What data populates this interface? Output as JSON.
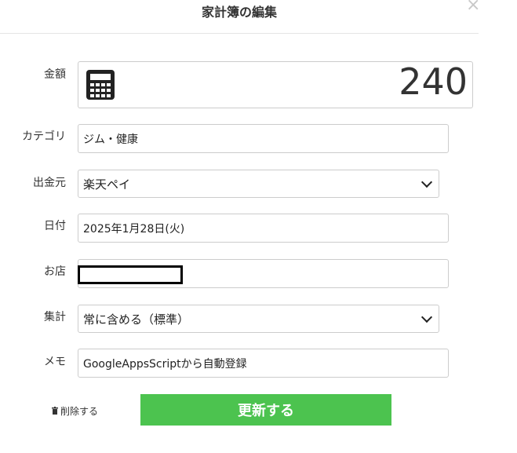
{
  "dialog": {
    "title": "家計簿の編集",
    "close_symbol": "×"
  },
  "form": {
    "amount": {
      "label": "金額",
      "value": "240",
      "icon": "calculator-icon"
    },
    "category": {
      "label": "カテゴリ",
      "value": "ジム・健康"
    },
    "payment_source": {
      "label": "出金元",
      "selected": "楽天ペイ"
    },
    "date": {
      "label": "日付",
      "value": "2025年1月28日(火)"
    },
    "shop": {
      "label": "お店",
      "value": ""
    },
    "aggregation": {
      "label": "集計",
      "selected": "常に含める（標準）"
    },
    "memo": {
      "label": "メモ",
      "value": "GoogleAppsScriptから自動登録"
    }
  },
  "actions": {
    "delete_label": "削除する",
    "submit_label": "更新する"
  },
  "colors": {
    "submit_bg": "#4cc34f",
    "border": "#cccccc",
    "text": "#333333"
  }
}
